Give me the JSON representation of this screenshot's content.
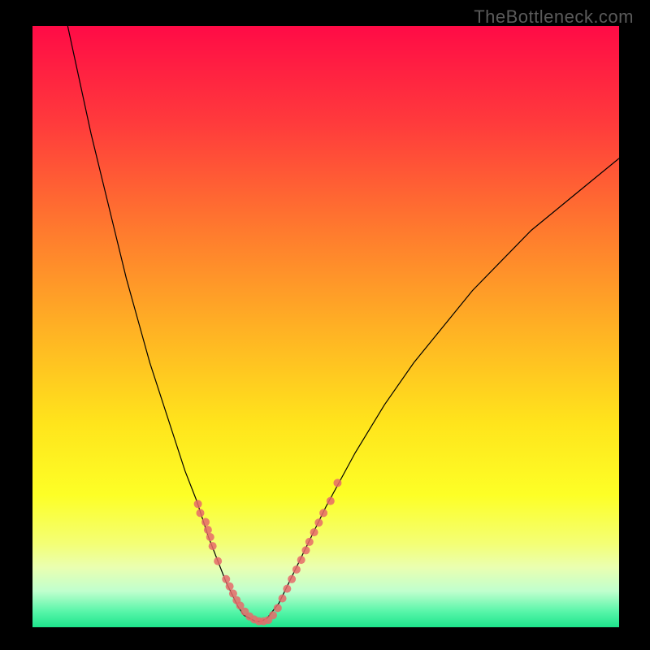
{
  "watermark": "TheBottleneck.com",
  "chart_data": {
    "type": "line",
    "title": "",
    "xlabel": "",
    "ylabel": "",
    "xlim": [
      0,
      100
    ],
    "ylim": [
      0,
      100
    ],
    "grid": false,
    "series": [
      {
        "name": "bottleneck-curve",
        "color": "#000000",
        "stroke_width": 1.2,
        "x": [
          6,
          8,
          10,
          12,
          14,
          16,
          18,
          20,
          22,
          24,
          26,
          28,
          30,
          31,
          32,
          33,
          34,
          35,
          36,
          37,
          38,
          39,
          40,
          42,
          44,
          46,
          48,
          50,
          55,
          60,
          65,
          70,
          75,
          80,
          85,
          90,
          95,
          100
        ],
        "y": [
          100,
          91,
          82,
          74,
          66,
          58,
          51,
          44,
          38,
          32,
          26,
          21,
          15,
          12.5,
          10,
          7.5,
          5.5,
          3.5,
          2,
          1.5,
          1,
          1,
          1.5,
          4,
          8,
          12,
          16,
          20,
          29,
          37,
          44,
          50,
          56,
          61,
          66,
          70,
          74,
          78
        ]
      },
      {
        "name": "highlight-dots-left",
        "color": "#e66a6a",
        "type": "scatter",
        "marker_size": 10,
        "x": [
          28.2,
          28.6,
          29.5,
          29.9,
          30.3,
          30.7,
          31.6,
          33.0,
          33.6,
          34.2,
          34.8,
          35.4,
          36.2,
          37.0,
          37.8,
          38.6,
          39.4,
          40.2
        ],
        "y": [
          20.5,
          19.0,
          17.5,
          16.2,
          15.0,
          13.5,
          11.0,
          8.0,
          6.8,
          5.6,
          4.5,
          3.6,
          2.6,
          1.8,
          1.3,
          1.0,
          1.0,
          1.2
        ]
      },
      {
        "name": "highlight-dots-right",
        "color": "#e66a6a",
        "type": "scatter",
        "marker_size": 10,
        "x": [
          41.0,
          41.8,
          42.6,
          43.4,
          44.2,
          45.0,
          45.8,
          46.6,
          47.2,
          48.0,
          48.8,
          49.6,
          50.8,
          52.0
        ],
        "y": [
          2.0,
          3.2,
          4.8,
          6.4,
          8.0,
          9.6,
          11.2,
          12.8,
          14.2,
          15.8,
          17.4,
          19.0,
          21.0,
          24.0
        ]
      }
    ],
    "background_gradient": {
      "type": "vertical",
      "stops": [
        {
          "offset": 0.0,
          "color": "#ff0b46"
        },
        {
          "offset": 0.16,
          "color": "#ff3a3c"
        },
        {
          "offset": 0.34,
          "color": "#ff7a2e"
        },
        {
          "offset": 0.5,
          "color": "#ffb024"
        },
        {
          "offset": 0.66,
          "color": "#ffe41c"
        },
        {
          "offset": 0.78,
          "color": "#fdff26"
        },
        {
          "offset": 0.86,
          "color": "#f4ff74"
        },
        {
          "offset": 0.9,
          "color": "#eaffb0"
        },
        {
          "offset": 0.94,
          "color": "#c0ffce"
        },
        {
          "offset": 0.975,
          "color": "#55f5a8"
        },
        {
          "offset": 1.0,
          "color": "#1de48c"
        }
      ]
    }
  }
}
